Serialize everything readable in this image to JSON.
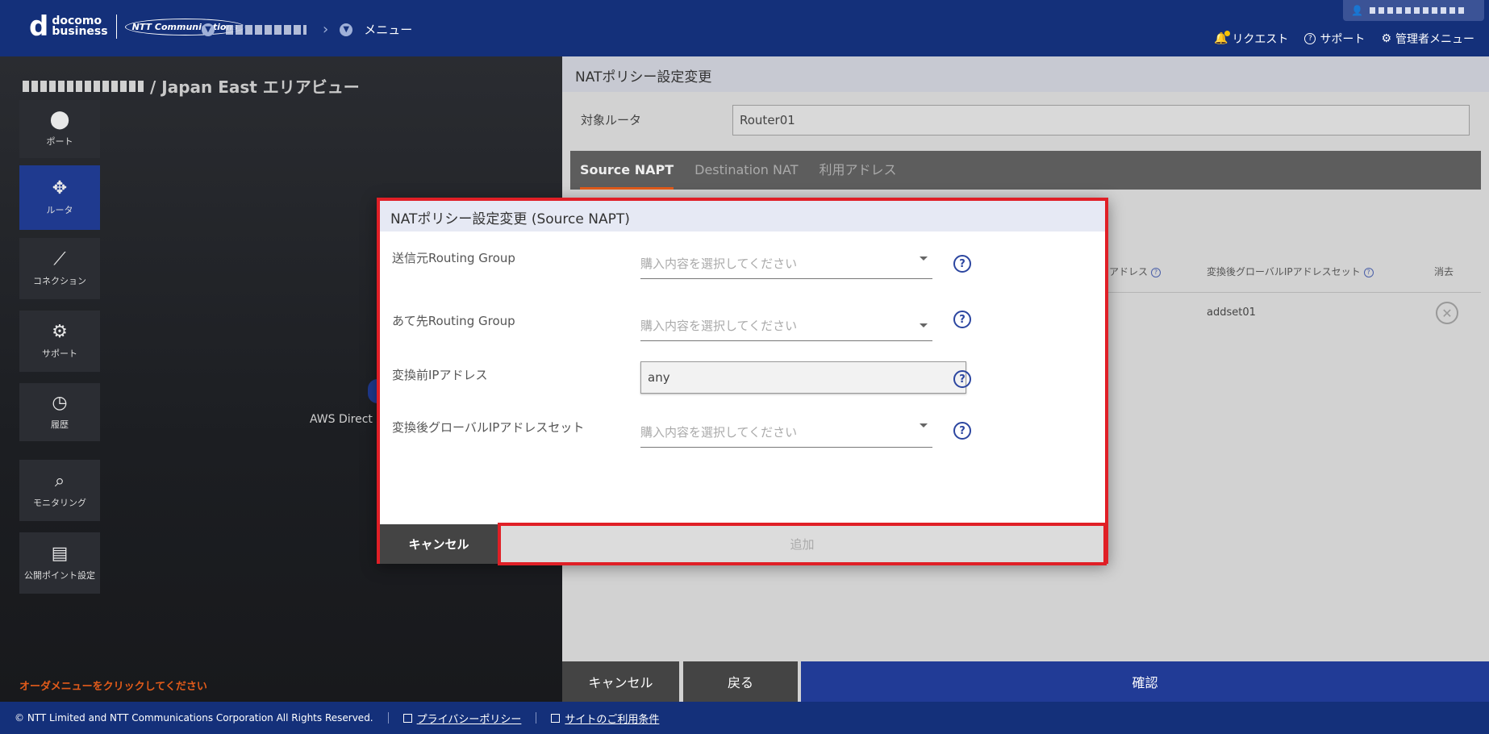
{
  "header": {
    "logo_d": "d",
    "logo_line1": "docomo",
    "logo_line2": "business",
    "logo_ntt": "NTT Communications",
    "menu_label": "メニュー",
    "nav": {
      "request": "リクエスト",
      "support": "サポート",
      "admin": "管理者メニュー"
    }
  },
  "area": {
    "title": "/ Japan East エリアビュー",
    "aws_label": "AWS Direct"
  },
  "sidebar": {
    "items": [
      {
        "label": "ポート",
        "icon": "port-icon"
      },
      {
        "label": "ルータ",
        "icon": "router-icon"
      },
      {
        "label": "コネクション",
        "icon": "connection-icon"
      },
      {
        "label": "サポート",
        "icon": "support-icon"
      },
      {
        "label": "履歴",
        "icon": "history-icon"
      },
      {
        "label": "モニタリング",
        "icon": "monitoring-icon"
      },
      {
        "label": "公開ポイント設定",
        "icon": "publish-icon"
      }
    ],
    "order_hint": "オーダメニューをクリックしてください"
  },
  "panel": {
    "title": "NATポリシー設定変更",
    "target_label": "対象ルータ",
    "target_value": "Router01",
    "tabs": [
      "Source NAPT",
      "Destination NAT",
      "利用アドレス"
    ],
    "table": {
      "col_partial": "アドレス",
      "col_global_set": "変換後グローバルIPアドレスセット",
      "col_delete": "消去",
      "row_global_set": "addset01"
    },
    "buttons": {
      "cancel": "キャンセル",
      "back": "戻る",
      "confirm": "確認"
    }
  },
  "modal": {
    "title": "NATポリシー設定変更 (Source NAPT)",
    "fields": {
      "src_label": "送信元Routing Group",
      "src_placeholder": "購入内容を選択してください",
      "dst_label": "あて先Routing Group",
      "dst_placeholder": "購入内容を選択してください",
      "pre_ip_label": "変換前IPアドレス",
      "pre_ip_value": "any",
      "post_set_label": "変換後グローバルIPアドレスセット",
      "post_set_placeholder": "購入内容を選択してください"
    },
    "cancel": "キャンセル",
    "add": "追加"
  },
  "footer": {
    "copyright": "© NTT Limited and NTT Communications Corporation All Rights Reserved.",
    "privacy": "プライバシーポリシー",
    "terms": "サイトのご利用条件"
  },
  "colors": {
    "header": "#14307a",
    "accent_orange": "#e25b1a",
    "highlight_red": "#e01f26",
    "confirm_blue": "#213b96"
  }
}
